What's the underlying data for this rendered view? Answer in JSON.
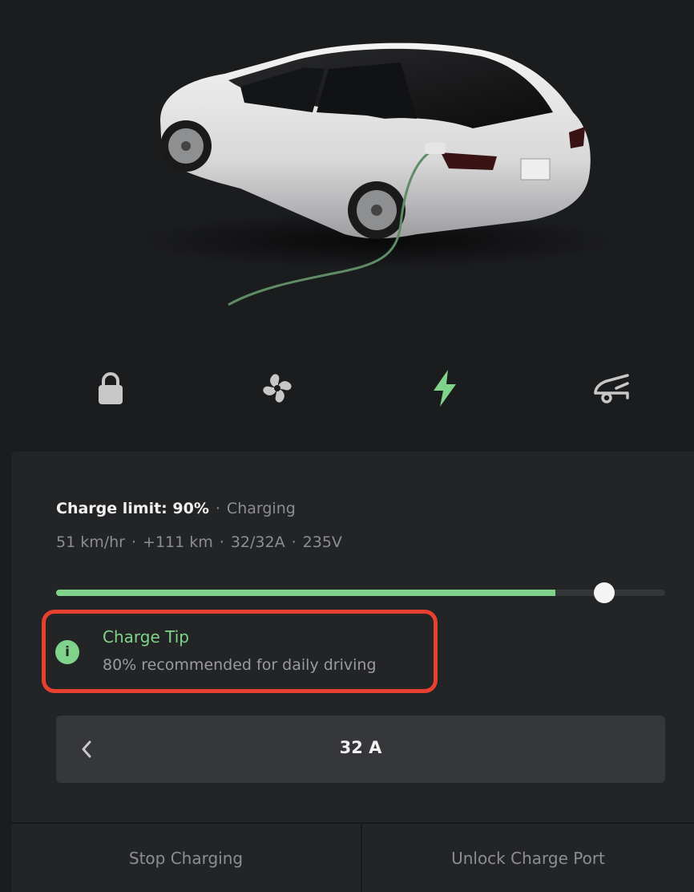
{
  "car": {
    "image_name": "model-3-white-charging"
  },
  "controls": {
    "icons": [
      {
        "name": "lock-icon",
        "color": "#c7c7c8"
      },
      {
        "name": "fan-icon",
        "color": "#c7c7c8"
      },
      {
        "name": "lightning-icon",
        "color": "#7fd38a"
      },
      {
        "name": "trunk-open-icon",
        "color": "#c7c7c8"
      }
    ]
  },
  "charge": {
    "limit_label": "Charge limit: 90%",
    "separator": "·",
    "state": "Charging",
    "rate": "51 km/hr",
    "added": "+111 km",
    "current": "32/32A",
    "voltage": "235V",
    "battery_level_fraction": 0.82,
    "limit_fraction": 0.9
  },
  "tip": {
    "icon_glyph": "i",
    "title": "Charge Tip",
    "text": "80% recommended for daily driving"
  },
  "amps": {
    "value": "32 A"
  },
  "actions": {
    "stop_label": "Stop Charging",
    "unlock_label": "Unlock Charge Port"
  },
  "colors": {
    "accent_green": "#7fd38a",
    "highlight_red": "#e8402e",
    "background": "#1b1c1e",
    "panel": "#232426"
  }
}
